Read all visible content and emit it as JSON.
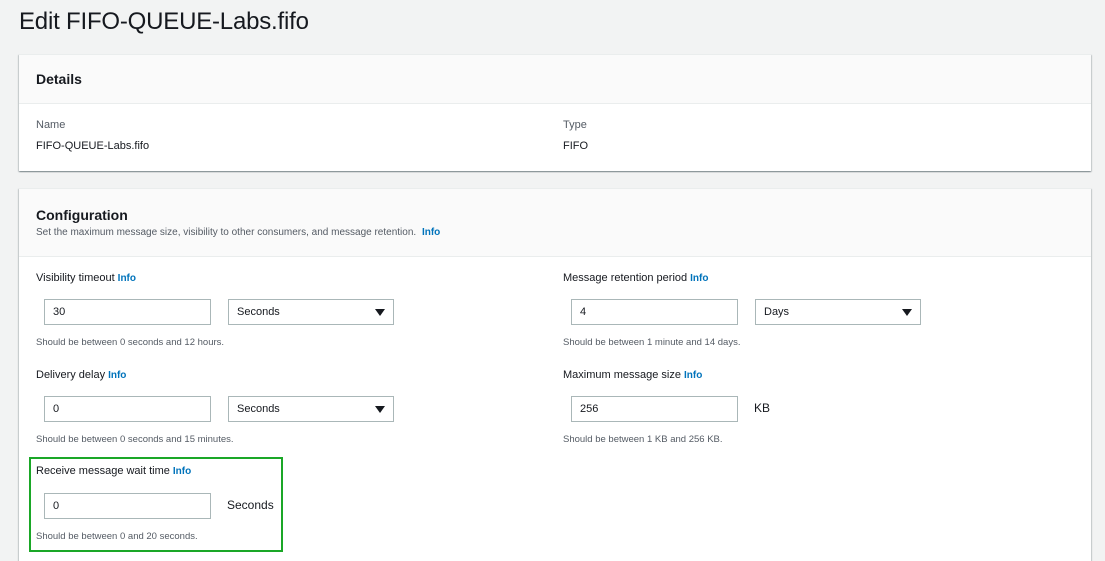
{
  "page": {
    "title": "Edit FIFO-QUEUE-Labs.fifo"
  },
  "details": {
    "title": "Details",
    "name_label": "Name",
    "name_value": "FIFO-QUEUE-Labs.fifo",
    "type_label": "Type",
    "type_value": "FIFO"
  },
  "config": {
    "title": "Configuration",
    "description": "Set the maximum message size, visibility to other consumers, and message retention.",
    "info": "Info",
    "visibility_timeout": {
      "label": "Visibility timeout",
      "value": "30",
      "unit": "Seconds",
      "hint": "Should be between 0 seconds and 12 hours."
    },
    "retention_period": {
      "label": "Message retention period",
      "value": "4",
      "unit": "Days",
      "hint": "Should be between 1 minute and 14 days."
    },
    "delivery_delay": {
      "label": "Delivery delay",
      "value": "0",
      "unit": "Seconds",
      "hint": "Should be between 0 seconds and 15 minutes."
    },
    "max_message_size": {
      "label": "Maximum message size",
      "value": "256",
      "unit": "KB",
      "hint": "Should be between 1 KB and 256 KB."
    },
    "receive_wait_time": {
      "label": "Receive message wait time",
      "value": "0",
      "unit": "Seconds",
      "hint": "Should be between 0 and 20 seconds."
    }
  },
  "colors": {
    "link": "#0073bb",
    "highlight": "#1aa727",
    "background": "#f2f3f3"
  }
}
